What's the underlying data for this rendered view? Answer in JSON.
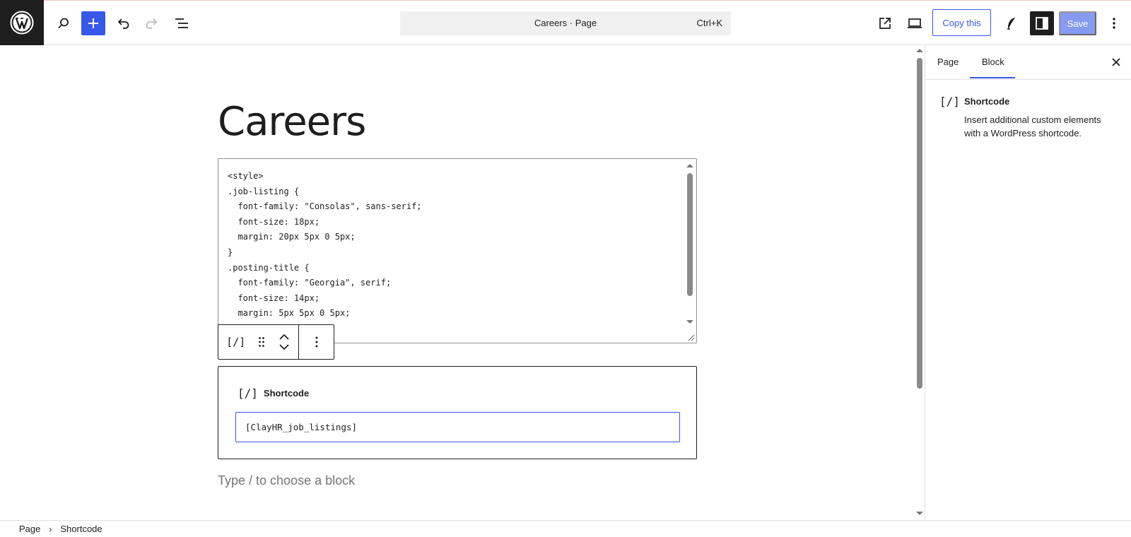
{
  "app": {
    "accent_color": "#3858e9",
    "logo_icon": "wordpress-logo-icon"
  },
  "toolbar": {
    "command_title": "Careers · Page",
    "command_shortcut": "Ctrl+K",
    "copy_label": "Copy this",
    "save_label": "Save",
    "icons": [
      "search-icon",
      "add-block-icon",
      "undo-icon",
      "redo-icon",
      "document-overview-icon",
      "view-page-icon",
      "preview-device-icon",
      "copy-this-button",
      "style-icon",
      "settings-panel-icon",
      "options-icon"
    ]
  },
  "editor": {
    "page_title": "Careers",
    "code_lines": [
      "<style>",
      ".job-listing {",
      "  font-family: \"Consolas\", sans-serif;",
      "  font-size: 18px;",
      "  margin: 20px 5px 0 5px;",
      "}",
      ".posting-title {",
      "  font-family: \"Georgia\", serif;",
      "  font-size: 14px;",
      "  margin: 5px 5px 0 5px;"
    ],
    "block_toolbar": {
      "block_icon": "[/]"
    },
    "shortcode_block": {
      "icon": "[/]",
      "label": "Shortcode",
      "value": "[ClayHR_job_listings]"
    },
    "empty_block_placeholder": "Type / to choose a block"
  },
  "sidebar": {
    "tabs": [
      {
        "label": "Page",
        "active": false
      },
      {
        "label": "Block",
        "active": true
      }
    ],
    "block_card": {
      "icon": "[/]",
      "title": "Shortcode",
      "description": "Insert additional custom elements with a WordPress shortcode."
    }
  },
  "footer": {
    "breadcrumb": [
      "Page",
      "Shortcode"
    ]
  }
}
